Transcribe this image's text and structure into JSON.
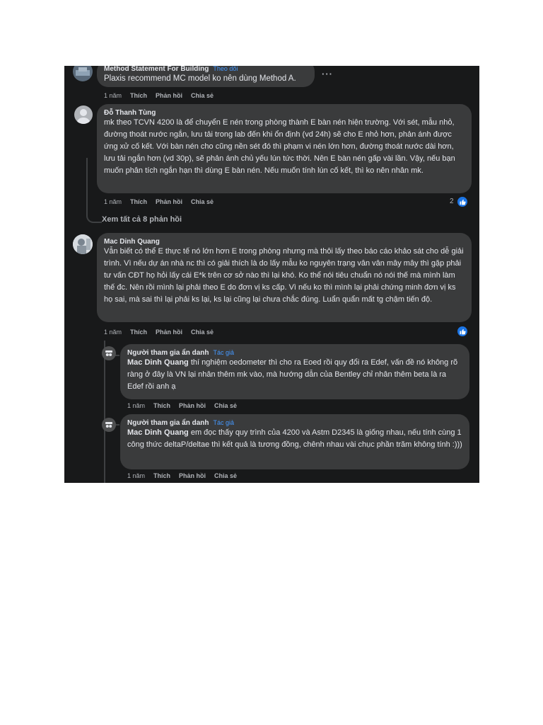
{
  "comments": [
    {
      "name": "Method Statement For Building",
      "badge": "Theo dõi",
      "text": "Plaxis recommend MC model ko nên dùng Method A.",
      "more": "···",
      "actions": {
        "time": "1 năm",
        "like": "Thích",
        "reply": "Phản hồi",
        "share": "Chia sẻ"
      }
    },
    {
      "name": "Đỗ Thanh Tùng",
      "text": "mk theo TCVN 4200 là để chuyển E nén trong phòng thành E bàn nén hiện trường. Với sét, mẫu nhỏ, đường thoát nước ngắn, lưu tải trong lab đến khi ổn định (vd 24h) sẽ cho E nhỏ hơn, phản ánh được ứng xử cố kết. Với bàn nén cho cũng nền sét đó thì phạm vi nén lớn hơn, đường thoát nước dài hơn, lưu tải ngắn hơn (vd 30p), sẽ phản ánh chủ yếu lún tức thời. Nên E bàn nén gấp vài lần. Vậy, nếu bạn muốn phân tích ngắn hạn thì dùng E bàn nén. Nếu muốn tính lún cố kết, thì ko nên nhân mk.",
      "actions": {
        "time": "1 năm",
        "like": "Thích",
        "reply": "Phản hồi",
        "share": "Chia sẻ"
      },
      "reactions": "2",
      "view_all": "Xem tất cả 8 phản hồi"
    },
    {
      "name": "Mac Dinh Quang",
      "text": "Vẫn biết có thể E thực tế nó lớn hơn E trong phòng nhưng mà thôi lấy theo báo cáo khảo sát cho dễ giải trình. Vì nếu dự án nhà nc thì có giải thích là do lấy mẫu ko nguyên trạng vân vân mây mây thì gặp phải tư vấn CĐT họ hỏi lấy cái E*k trên cơ sở nào thì lại khó. Ko thể nói tiêu chuẩn nó nói thế mà mình làm thế đc. Nên rồi mình lại phải theo E do đơn vị ks cấp. Vì nếu ko thì mình lại phải chứng minh đơn vị ks họ sai, mà sai thì lại phải ks lại, ks lại cũng lại chưa chắc đúng. Luẩn quẩn mất tg chậm tiến độ.",
      "actions": {
        "time": "1 năm",
        "like": "Thích",
        "reply": "Phản hồi",
        "share": "Chia sẻ"
      }
    }
  ],
  "replies": [
    {
      "name": "Người tham gia ẩn danh",
      "badge": "Tác giả",
      "mention": "Mac Dinh Quang",
      "text": " thí nghiệm oedometer thì cho ra Eoed rồi quy đổi ra Edef, vấn đề nó không rõ ràng ở đây là VN lại nhân thêm mk vào, mà hướng dẫn của Bentley chỉ nhân thêm beta là ra Edef rồi anh ạ",
      "actions": {
        "time": "1 năm",
        "like": "Thích",
        "reply": "Phản hồi",
        "share": "Chia sẻ"
      }
    },
    {
      "name": "Người tham gia ẩn danh",
      "badge": "Tác giả",
      "mention": "Mac Dinh Quang",
      "text": " em đọc thấy quy trình của 4200 và Astm D2345 là giống nhau, nếu tính cùng 1 công thức deltaP/deltae thì kết quả là tương đồng, chênh nhau vài chục phần trăm không tính :)))",
      "actions": {
        "time": "1 năm",
        "like": "Thích",
        "reply": "Phản hồi",
        "share": "Chia sẻ"
      }
    }
  ],
  "colors": {
    "background": "#18191a",
    "bubble": "#3a3b3c",
    "text": "#e4e6eb",
    "muted": "#b0b3b8",
    "accent": "#1b74e4",
    "badge": "#4599ff"
  },
  "icons": {
    "like": "thumbs-up-icon",
    "anon": "anonymous-user-icon",
    "default_avatar": "default-avatar-icon"
  }
}
